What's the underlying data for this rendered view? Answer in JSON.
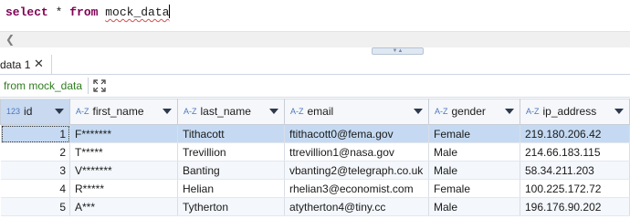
{
  "editor": {
    "kw_select": "select",
    "star": " * ",
    "kw_from": "from",
    "table_name": "mock_data"
  },
  "result_tab": {
    "label": "data 1",
    "close_glyph": "✕"
  },
  "filter": {
    "text": "from mock_data",
    "expand_icon": "expand-icon"
  },
  "grid": {
    "columns": [
      {
        "name": "id",
        "type_badge": "123"
      },
      {
        "name": "first_name",
        "type_badge": "A-Z"
      },
      {
        "name": "last_name",
        "type_badge": "A-Z"
      },
      {
        "name": "email",
        "type_badge": "A-Z"
      },
      {
        "name": "gender",
        "type_badge": "A-Z"
      },
      {
        "name": "ip_address",
        "type_badge": "A-Z"
      }
    ],
    "rows": [
      {
        "id": "1",
        "first_name": "F*******",
        "last_name": "Tithacott",
        "email": "ftithacott0@fema.gov",
        "gender": "Female",
        "ip_address": "219.180.206.42"
      },
      {
        "id": "2",
        "first_name": "T*****",
        "last_name": "Trevillion",
        "email": "ttrevillion1@nasa.gov",
        "gender": "Male",
        "ip_address": "214.66.183.115"
      },
      {
        "id": "3",
        "first_name": "V*******",
        "last_name": "Banting",
        "email": "vbanting2@telegraph.co.uk",
        "gender": "Male",
        "ip_address": "58.34.211.203"
      },
      {
        "id": "4",
        "first_name": "R*****",
        "last_name": "Helian",
        "email": "rhelian3@economist.com",
        "gender": "Female",
        "ip_address": "100.225.172.72"
      },
      {
        "id": "5",
        "first_name": "A***",
        "last_name": "Tytherton",
        "email": "atytherton4@tiny.cc",
        "gender": "Male",
        "ip_address": "196.176.90.202"
      }
    ]
  },
  "colors": {
    "keyword": "#7f0055",
    "selected_row": "#c5daf2",
    "filter_text": "#2e7d1e",
    "type_badge": "#4a78c2"
  }
}
